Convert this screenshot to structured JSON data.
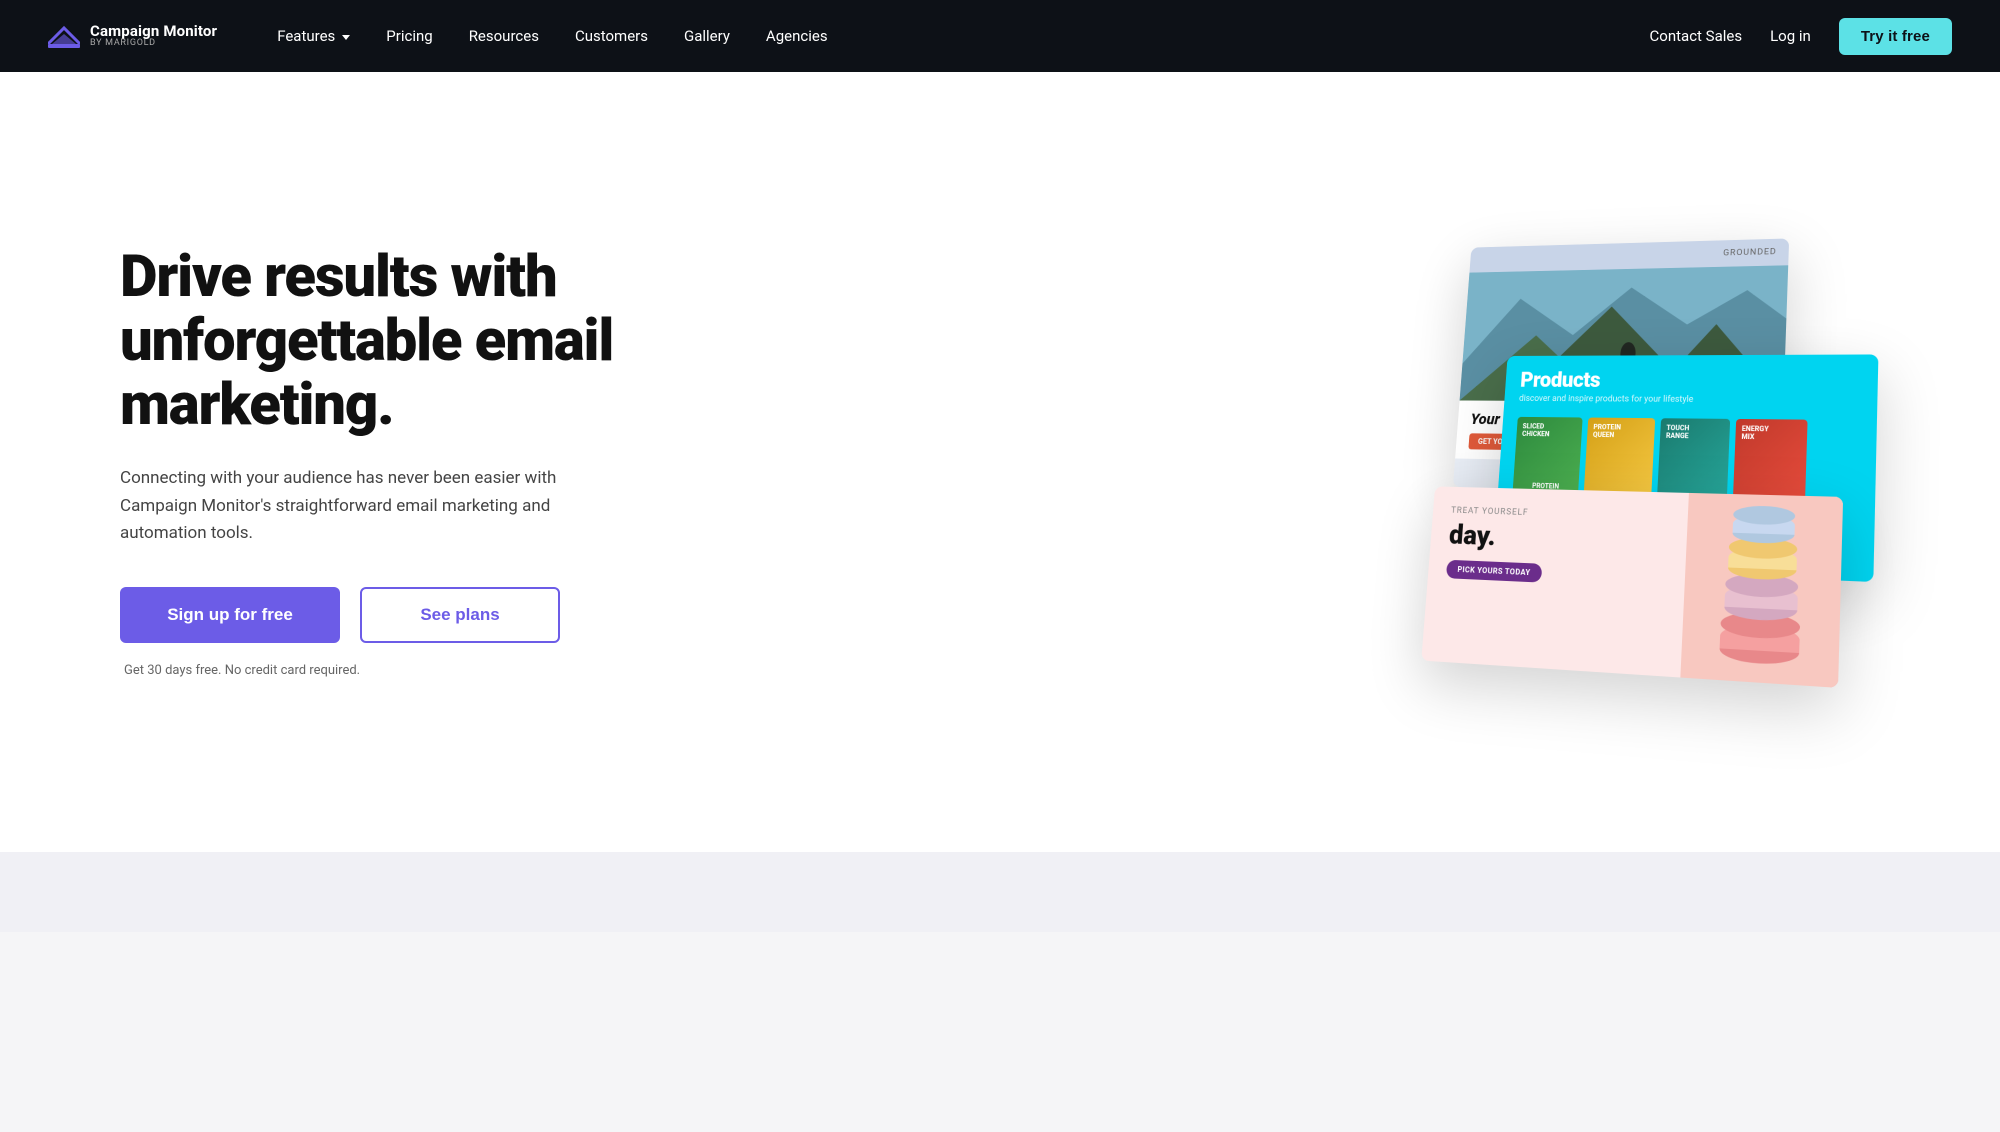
{
  "navbar": {
    "logo": {
      "main_name": "Campaign Monitor",
      "sub_name": "by Marigold",
      "icon_alt": "campaign-monitor-logo"
    },
    "nav_links": [
      {
        "label": "Features",
        "has_dropdown": true
      },
      {
        "label": "Pricing",
        "has_dropdown": false
      },
      {
        "label": "Resources",
        "has_dropdown": false
      },
      {
        "label": "Customers",
        "has_dropdown": false
      },
      {
        "label": "Gallery",
        "has_dropdown": false
      },
      {
        "label": "Agencies",
        "has_dropdown": false
      }
    ],
    "right_links": [
      {
        "label": "Contact Sales"
      },
      {
        "label": "Log in"
      }
    ],
    "cta_button": "Try it free"
  },
  "hero": {
    "title": "Drive results with unforgettable email marketing.",
    "subtitle": "Connecting with your audience has never been easier with Campaign Monitor's straightforward email marketing and automation tools.",
    "signup_button": "Sign up for free",
    "plans_button": "See plans",
    "note": "Get 30 days free. No credit card required."
  },
  "email_cards": {
    "mountain_card": {
      "brand": "GROUNDED",
      "title": "Your mountain is waiting!",
      "cta": "Get your tickets"
    },
    "products_card": {
      "title": "Products",
      "subtitle": "discover and inspire products for your lifestyle",
      "touch_range": "Touch range"
    },
    "macarons_card": {
      "small_text": "Pick yours today",
      "title": "day.",
      "cta": "Pick yours today"
    }
  }
}
